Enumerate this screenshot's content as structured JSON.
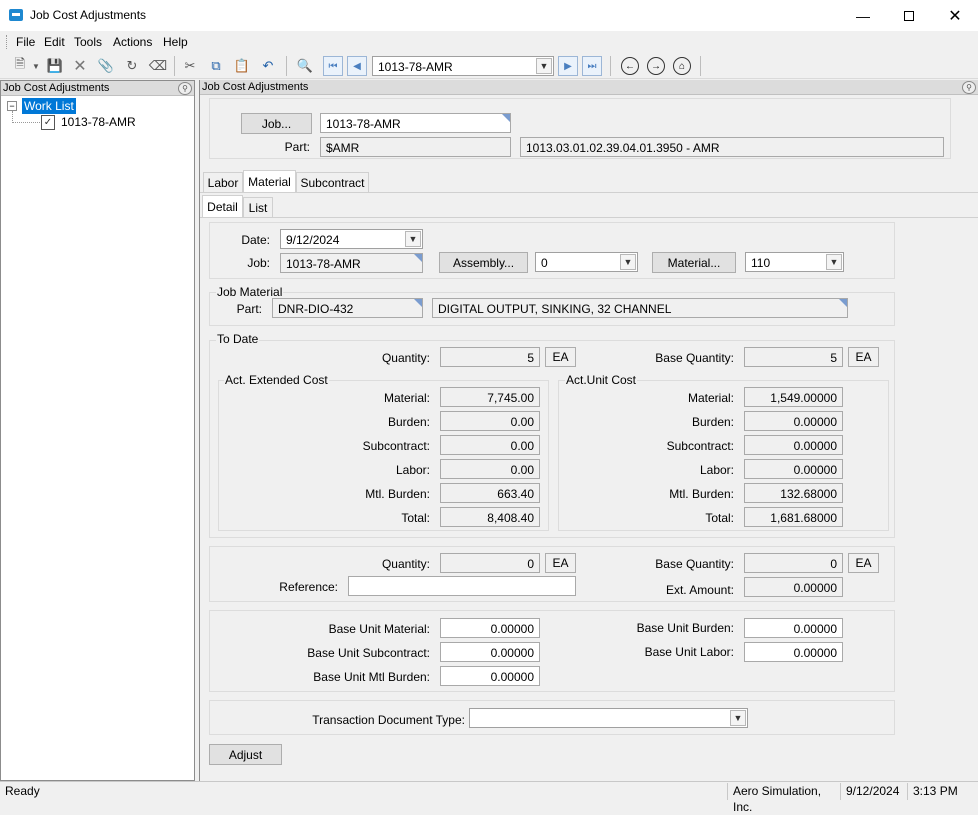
{
  "window": {
    "title": "Job Cost Adjustments"
  },
  "menu": [
    "File",
    "Edit",
    "Tools",
    "Actions",
    "Help"
  ],
  "toolbar": {
    "job_combo": "1013-78-AMR"
  },
  "tree": {
    "panel_title": "Job Cost Adjustments",
    "root": "Work List",
    "child": "1013-78-AMR"
  },
  "main": {
    "panel_title": "Job Cost Adjustments",
    "job_button": "Job...",
    "job_value": "1013-78-AMR",
    "part_label": "Part:",
    "part_value": "$AMR",
    "part_desc": "1013.03.01.02.39.04.01.3950 - AMR",
    "tabs": [
      "Labor",
      "Material",
      "Subcontract"
    ],
    "subtabs": [
      "Detail",
      "List"
    ],
    "date_label": "Date:",
    "date_value": "9/12/2024",
    "job_label": "Job:",
    "job_ro": "1013-78-AMR",
    "assembly_button": "Assembly...",
    "assembly_value": "0",
    "material_button": "Material...",
    "material_value": "110",
    "job_material_title": "Job Material",
    "jm_part_label": "Part:",
    "jm_part_value": "DNR-DIO-432",
    "jm_part_desc": "DIGITAL OUTPUT, SINKING, 32 CHANNEL",
    "todate": {
      "title": "To Date",
      "qty_label": "Quantity:",
      "qty_value": "5",
      "qty_uom": "EA",
      "base_qty_label": "Base Quantity:",
      "base_qty_value": "5",
      "base_qty_uom": "EA",
      "ext_title": "Act. Extended Cost",
      "unit_title": "Act.Unit Cost",
      "labels": [
        "Material:",
        "Burden:",
        "Subcontract:",
        "Labor:",
        "Mtl. Burden:",
        "Total:"
      ],
      "ext_values": [
        "7,745.00",
        "0.00",
        "0.00",
        "0.00",
        "663.40",
        "8,408.40"
      ],
      "unit_values": [
        "1,549.00000",
        "0.00000",
        "0.00000",
        "0.00000",
        "132.68000",
        "1,681.68000"
      ]
    },
    "adjust": {
      "qty_label": "Quantity:",
      "qty_value": "0",
      "qty_uom": "EA",
      "base_qty_label": "Base Quantity:",
      "base_qty_value": "0",
      "base_qty_uom": "EA",
      "reference_label": "Reference:",
      "reference_value": "",
      "ext_amount_label": "Ext. Amount:",
      "ext_amount_value": "0.00000"
    },
    "base": {
      "unit_material_label": "Base Unit Material:",
      "unit_material_value": "0.00000",
      "unit_subcontract_label": "Base Unit Subcontract:",
      "unit_subcontract_value": "0.00000",
      "unit_mtl_burden_label": "Base Unit Mtl Burden:",
      "unit_mtl_burden_value": "0.00000",
      "unit_burden_label": "Base Unit Burden:",
      "unit_burden_value": "0.00000",
      "unit_labor_label": "Base Unit Labor:",
      "unit_labor_value": "0.00000"
    },
    "trans_doc_label": "Transaction Document Type:",
    "trans_doc_value": "",
    "adjust_button": "Adjust"
  },
  "status": {
    "text": "Ready",
    "company": "Aero Simulation, Inc.",
    "date": "9/12/2024",
    "time": "3:13 PM"
  }
}
